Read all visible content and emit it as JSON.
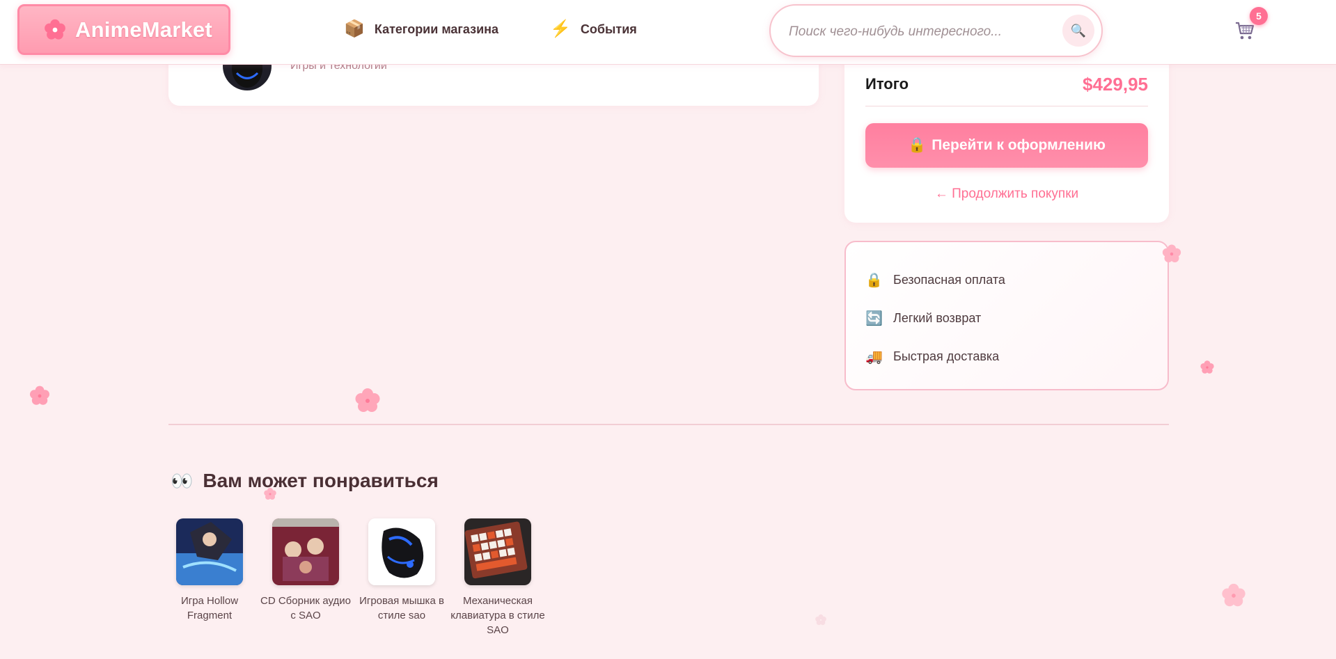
{
  "header": {
    "logo_text": "AnimeMarket",
    "nav": [
      {
        "label": "Категории магазина",
        "icon": "box-icon"
      },
      {
        "label": "События",
        "icon": "lightning-icon"
      }
    ],
    "search_placeholder": "Поиск чего-нибудь интересного...",
    "cart_count": "5"
  },
  "cart_item": {
    "category": "Игры и технологии"
  },
  "summary": {
    "total_label": "Итого",
    "total_value": "$429,95",
    "checkout_label": "Перейти к оформлению",
    "continue_label": "← Продолжить покупки"
  },
  "features": [
    {
      "label": "Безопасная оплата",
      "icon": "lock-icon"
    },
    {
      "label": "Легкий возврат",
      "icon": "refresh-icon"
    },
    {
      "label": "Быстрая доставка",
      "icon": "truck-icon"
    }
  ],
  "recommendations": {
    "title": "Вам может понравиться",
    "items": [
      {
        "name": "Игра Hollow Fragment"
      },
      {
        "name": "CD Сборник аудио с SAO"
      },
      {
        "name": "Игровая мышка в стиле sao"
      },
      {
        "name": "Механическая клавиатура в стиле SAO"
      }
    ]
  },
  "colors": {
    "accent": "#ff6f93",
    "background": "#fdeff1",
    "border_pink": "#f7bccb"
  }
}
